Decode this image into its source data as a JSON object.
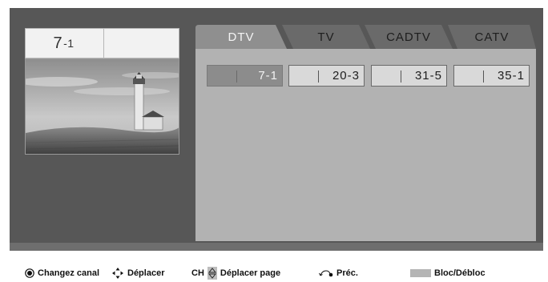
{
  "preview": {
    "channel_main": "7",
    "channel_sub": "-1"
  },
  "tabs": [
    {
      "label": "DTV",
      "active": true
    },
    {
      "label": "TV",
      "active": false
    },
    {
      "label": "CADTV",
      "active": false
    },
    {
      "label": "CATV",
      "active": false
    }
  ],
  "channels": [
    {
      "number": "7-1",
      "selected": true
    },
    {
      "number": "20-3",
      "selected": false
    },
    {
      "number": "31-5",
      "selected": false
    },
    {
      "number": "35-1",
      "selected": false
    }
  ],
  "footer": {
    "change_channel": "Changez canal",
    "move": "Déplacer",
    "ch_prefix": "CH",
    "move_page": "Déplacer page",
    "prev": "Préc.",
    "block": "Bloc/Débloc"
  },
  "colors": {
    "screen_bg": "#575757",
    "active_tab": "#8f8f8f",
    "inactive_tab": "#6a6a6a",
    "list_bg": "#b2b2b2",
    "selected_channel": "#8c8c8c"
  }
}
